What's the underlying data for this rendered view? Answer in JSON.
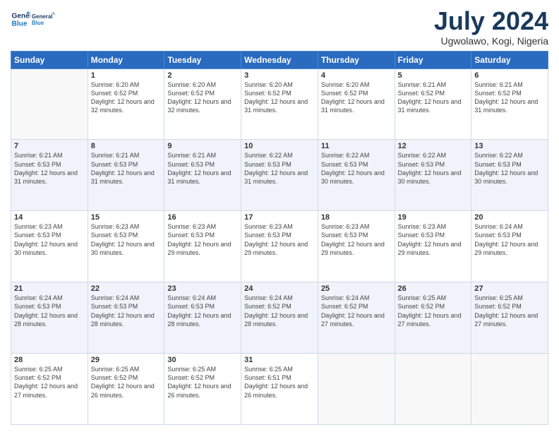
{
  "header": {
    "logo_line1": "General",
    "logo_line2": "Blue",
    "title": "July 2024",
    "subtitle": "Ugwolawo, Kogi, Nigeria"
  },
  "weekdays": [
    "Sunday",
    "Monday",
    "Tuesday",
    "Wednesday",
    "Thursday",
    "Friday",
    "Saturday"
  ],
  "weeks": [
    [
      {
        "day": "",
        "sunrise": "",
        "sunset": "",
        "daylight": ""
      },
      {
        "day": "1",
        "sunrise": "Sunrise: 6:20 AM",
        "sunset": "Sunset: 6:52 PM",
        "daylight": "Daylight: 12 hours and 32 minutes."
      },
      {
        "day": "2",
        "sunrise": "Sunrise: 6:20 AM",
        "sunset": "Sunset: 6:52 PM",
        "daylight": "Daylight: 12 hours and 32 minutes."
      },
      {
        "day": "3",
        "sunrise": "Sunrise: 6:20 AM",
        "sunset": "Sunset: 6:52 PM",
        "daylight": "Daylight: 12 hours and 31 minutes."
      },
      {
        "day": "4",
        "sunrise": "Sunrise: 6:20 AM",
        "sunset": "Sunset: 6:52 PM",
        "daylight": "Daylight: 12 hours and 31 minutes."
      },
      {
        "day": "5",
        "sunrise": "Sunrise: 6:21 AM",
        "sunset": "Sunset: 6:52 PM",
        "daylight": "Daylight: 12 hours and 31 minutes."
      },
      {
        "day": "6",
        "sunrise": "Sunrise: 6:21 AM",
        "sunset": "Sunset: 6:52 PM",
        "daylight": "Daylight: 12 hours and 31 minutes."
      }
    ],
    [
      {
        "day": "7",
        "sunrise": "Sunrise: 6:21 AM",
        "sunset": "Sunset: 6:53 PM",
        "daylight": "Daylight: 12 hours and 31 minutes."
      },
      {
        "day": "8",
        "sunrise": "Sunrise: 6:21 AM",
        "sunset": "Sunset: 6:53 PM",
        "daylight": "Daylight: 12 hours and 31 minutes."
      },
      {
        "day": "9",
        "sunrise": "Sunrise: 6:21 AM",
        "sunset": "Sunset: 6:53 PM",
        "daylight": "Daylight: 12 hours and 31 minutes."
      },
      {
        "day": "10",
        "sunrise": "Sunrise: 6:22 AM",
        "sunset": "Sunset: 6:53 PM",
        "daylight": "Daylight: 12 hours and 31 minutes."
      },
      {
        "day": "11",
        "sunrise": "Sunrise: 6:22 AM",
        "sunset": "Sunset: 6:53 PM",
        "daylight": "Daylight: 12 hours and 30 minutes."
      },
      {
        "day": "12",
        "sunrise": "Sunrise: 6:22 AM",
        "sunset": "Sunset: 6:53 PM",
        "daylight": "Daylight: 12 hours and 30 minutes."
      },
      {
        "day": "13",
        "sunrise": "Sunrise: 6:22 AM",
        "sunset": "Sunset: 6:53 PM",
        "daylight": "Daylight: 12 hours and 30 minutes."
      }
    ],
    [
      {
        "day": "14",
        "sunrise": "Sunrise: 6:23 AM",
        "sunset": "Sunset: 6:53 PM",
        "daylight": "Daylight: 12 hours and 30 minutes."
      },
      {
        "day": "15",
        "sunrise": "Sunrise: 6:23 AM",
        "sunset": "Sunset: 6:53 PM",
        "daylight": "Daylight: 12 hours and 30 minutes."
      },
      {
        "day": "16",
        "sunrise": "Sunrise: 6:23 AM",
        "sunset": "Sunset: 6:53 PM",
        "daylight": "Daylight: 12 hours and 29 minutes."
      },
      {
        "day": "17",
        "sunrise": "Sunrise: 6:23 AM",
        "sunset": "Sunset: 6:53 PM",
        "daylight": "Daylight: 12 hours and 29 minutes."
      },
      {
        "day": "18",
        "sunrise": "Sunrise: 6:23 AM",
        "sunset": "Sunset: 6:53 PM",
        "daylight": "Daylight: 12 hours and 29 minutes."
      },
      {
        "day": "19",
        "sunrise": "Sunrise: 6:23 AM",
        "sunset": "Sunset: 6:53 PM",
        "daylight": "Daylight: 12 hours and 29 minutes."
      },
      {
        "day": "20",
        "sunrise": "Sunrise: 6:24 AM",
        "sunset": "Sunset: 6:53 PM",
        "daylight": "Daylight: 12 hours and 29 minutes."
      }
    ],
    [
      {
        "day": "21",
        "sunrise": "Sunrise: 6:24 AM",
        "sunset": "Sunset: 6:53 PM",
        "daylight": "Daylight: 12 hours and 28 minutes."
      },
      {
        "day": "22",
        "sunrise": "Sunrise: 6:24 AM",
        "sunset": "Sunset: 6:53 PM",
        "daylight": "Daylight: 12 hours and 28 minutes."
      },
      {
        "day": "23",
        "sunrise": "Sunrise: 6:24 AM",
        "sunset": "Sunset: 6:53 PM",
        "daylight": "Daylight: 12 hours and 28 minutes."
      },
      {
        "day": "24",
        "sunrise": "Sunrise: 6:24 AM",
        "sunset": "Sunset: 6:52 PM",
        "daylight": "Daylight: 12 hours and 28 minutes."
      },
      {
        "day": "25",
        "sunrise": "Sunrise: 6:24 AM",
        "sunset": "Sunset: 6:52 PM",
        "daylight": "Daylight: 12 hours and 27 minutes."
      },
      {
        "day": "26",
        "sunrise": "Sunrise: 6:25 AM",
        "sunset": "Sunset: 6:52 PM",
        "daylight": "Daylight: 12 hours and 27 minutes."
      },
      {
        "day": "27",
        "sunrise": "Sunrise: 6:25 AM",
        "sunset": "Sunset: 6:52 PM",
        "daylight": "Daylight: 12 hours and 27 minutes."
      }
    ],
    [
      {
        "day": "28",
        "sunrise": "Sunrise: 6:25 AM",
        "sunset": "Sunset: 6:52 PM",
        "daylight": "Daylight: 12 hours and 27 minutes."
      },
      {
        "day": "29",
        "sunrise": "Sunrise: 6:25 AM",
        "sunset": "Sunset: 6:52 PM",
        "daylight": "Daylight: 12 hours and 26 minutes."
      },
      {
        "day": "30",
        "sunrise": "Sunrise: 6:25 AM",
        "sunset": "Sunset: 6:52 PM",
        "daylight": "Daylight: 12 hours and 26 minutes."
      },
      {
        "day": "31",
        "sunrise": "Sunrise: 6:25 AM",
        "sunset": "Sunset: 6:51 PM",
        "daylight": "Daylight: 12 hours and 26 minutes."
      },
      {
        "day": "",
        "sunrise": "",
        "sunset": "",
        "daylight": ""
      },
      {
        "day": "",
        "sunrise": "",
        "sunset": "",
        "daylight": ""
      },
      {
        "day": "",
        "sunrise": "",
        "sunset": "",
        "daylight": ""
      }
    ]
  ]
}
